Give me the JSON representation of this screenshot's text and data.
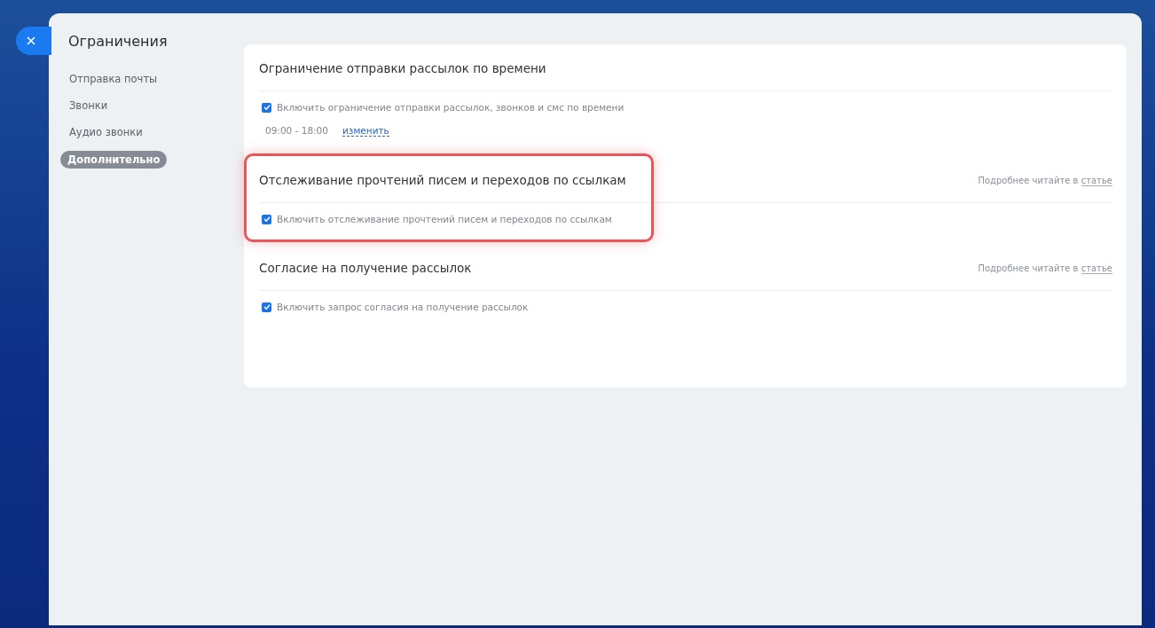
{
  "panel": {
    "title": "Ограничения"
  },
  "nav": [
    {
      "label": "Отправка почты",
      "selected": false
    },
    {
      "label": "Звонки",
      "selected": false
    },
    {
      "label": "Аудио звонки",
      "selected": false
    },
    {
      "label": "Дополнительно",
      "selected": true
    }
  ],
  "sections": [
    {
      "title": "Ограничение отправки рассылок по времени",
      "highlighted": false,
      "checkbox": {
        "label": "Включить ограничение отправки рассылок, звонков и смс по времени",
        "checked": true
      },
      "time_range": "09:00 - 18:00",
      "edit_link": "изменить"
    },
    {
      "title": "Отслеживание прочтений писем и переходов по ссылкам",
      "highlighted": true,
      "hint": "Подробнее читайте в",
      "hint_link": "статье",
      "checkbox": {
        "label": "Включить отслеживание прочтений писем и переходов по ссылкам",
        "checked": true
      }
    },
    {
      "title": "Согласие на получение рассылок",
      "highlighted": false,
      "hint": "Подробнее читайте в",
      "hint_link": "статье",
      "checkbox": {
        "label": "Включить запрос согласия на получение рассылок",
        "checked": true
      }
    }
  ]
}
